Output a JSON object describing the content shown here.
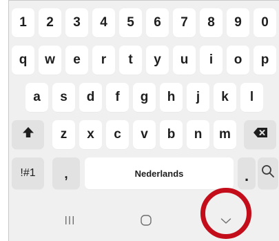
{
  "keyboard": {
    "numbers": [
      "1",
      "2",
      "3",
      "4",
      "5",
      "6",
      "7",
      "8",
      "9",
      "0"
    ],
    "row1": [
      "q",
      "w",
      "e",
      "r",
      "t",
      "y",
      "u",
      "i",
      "o",
      "p"
    ],
    "row2": [
      "a",
      "s",
      "d",
      "f",
      "g",
      "h",
      "j",
      "k",
      "l"
    ],
    "row3": [
      "z",
      "x",
      "c",
      "v",
      "b",
      "n",
      "m"
    ],
    "symbols_label": "!#1",
    "comma_label": ",",
    "space_label": "Nederlands",
    "period_label": ".",
    "shift_icon": "shift-arrow-icon",
    "backspace_icon": "backspace-icon",
    "search_icon": "search-icon"
  },
  "navbar": {
    "recents_icon": "recents-icon",
    "home_icon": "home-icon",
    "hide_keyboard_icon": "chevron-down-icon"
  },
  "annotation": {
    "highlight_color": "#c40d1b"
  }
}
